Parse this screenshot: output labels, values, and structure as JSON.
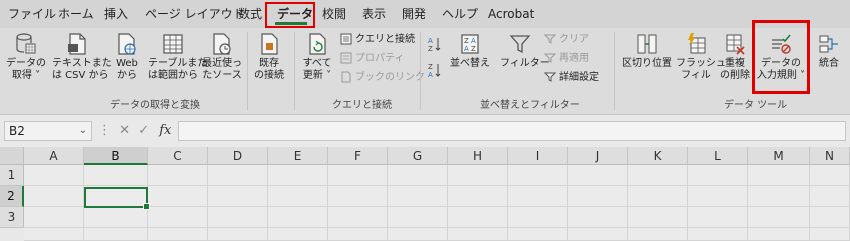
{
  "menu": {
    "items": [
      "ファイル",
      "ホーム",
      "挿入",
      "ページ レイアウト",
      "数式",
      "データ",
      "校閲",
      "表示",
      "開発",
      "ヘルプ",
      "Acrobat"
    ],
    "active": "データ"
  },
  "ribbon": {
    "get_data": {
      "l1": "データの",
      "l2": "取得 ˅"
    },
    "text_csv": {
      "l1": "テキストまた",
      "l2": "は CSV から"
    },
    "web": {
      "l1": "Web",
      "l2": "から"
    },
    "table_range": {
      "l1": "テーブルまた",
      "l2": "は範囲から"
    },
    "recent_sources": {
      "l1": "最近使っ",
      "l2": "たソース"
    },
    "existing_conn": {
      "l1": "既存",
      "l2": "の接続"
    },
    "group_get_data": "データの取得と変換",
    "refresh_all": {
      "l1": "すべて",
      "l2": "更新 ˅"
    },
    "queries_conn": "クエリと接続",
    "properties": "プロパティ",
    "edit_links": "ブックのリンク",
    "group_queries": "クエリと接続",
    "sort_az": "A→Z",
    "sort_za": "Z→A",
    "sort": "並べ替え",
    "filter": "フィルター",
    "clear": "クリア",
    "reapply": "再適用",
    "advanced": "詳細設定",
    "group_sort_filter": "並べ替えとフィルター",
    "text_to_columns": "区切り位置",
    "flash_fill": {
      "l1": "フラッシュ",
      "l2": "フィル"
    },
    "remove_dup": {
      "l1": "重複",
      "l2": "の削除"
    },
    "data_validation": {
      "l1": "データの",
      "l2": "入力規則 ˅"
    },
    "consolidate": "統合",
    "group_data_tools": "データ ツール"
  },
  "formula_bar": {
    "name_box": "B2",
    "fx": "fx",
    "formula": ""
  },
  "grid": {
    "columns": [
      "A",
      "B",
      "C",
      "D",
      "E",
      "F",
      "G",
      "H",
      "I",
      "J",
      "K",
      "L",
      "M",
      "N"
    ],
    "rows": [
      "1",
      "2",
      "3"
    ],
    "active_cell": "B2"
  },
  "colors": {
    "highlight_red": "#e00000",
    "excel_green": "#1f7a3a"
  },
  "icons": [
    "get-data-icon",
    "csv-file-icon",
    "web-icon",
    "table-icon",
    "recent-sources-icon",
    "existing-connections-icon",
    "refresh-icon",
    "queries-icon",
    "properties-icon",
    "links-icon",
    "sort-az-icon",
    "sort-za-icon",
    "sort-icon",
    "filter-icon",
    "clear-filter-icon",
    "reapply-icon",
    "advanced-filter-icon",
    "text-to-columns-icon",
    "flash-fill-icon",
    "remove-duplicates-icon",
    "data-validation-icon",
    "consolidate-icon",
    "fx-icon"
  ]
}
